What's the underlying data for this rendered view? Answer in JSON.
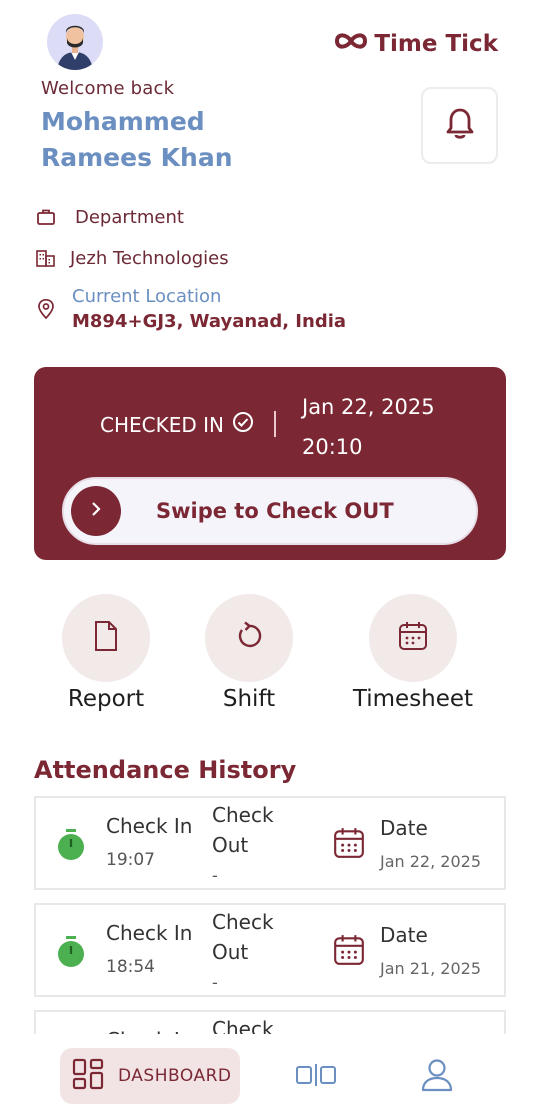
{
  "header": {
    "brand": "Time Tick",
    "welcome": "Welcome back",
    "user_name": "Mohammed Ramees Khan"
  },
  "info": {
    "department": "Department",
    "company": "Jezh Technologies",
    "location_label": "Current Location",
    "location_value": "M894+GJ3, Wayanad, India"
  },
  "check_card": {
    "status": "CHECKED IN",
    "date": "Jan 22, 2025",
    "time": "20:10",
    "swipe_label": "Swipe to Check OUT"
  },
  "actions": [
    {
      "label": "Report",
      "icon": "file-icon"
    },
    {
      "label": "Shift",
      "icon": "refresh-icon"
    },
    {
      "label": "Timesheet",
      "icon": "calendar-icon"
    }
  ],
  "history": {
    "title": "Attendance History",
    "checkin_label": "Check In",
    "checkout_label": "Check Out",
    "date_label": "Date",
    "records": [
      {
        "check_in": "19:07",
        "check_out": "-",
        "date": "Jan 22, 2025"
      },
      {
        "check_in": "18:54",
        "check_out": "-",
        "date": "Jan 21, 2025"
      },
      {
        "check_in": "",
        "check_out": "",
        "date": ""
      }
    ]
  },
  "nav": {
    "dashboard": "DASHBOARD"
  },
  "colors": {
    "primary": "#7b2834",
    "accent_blue": "#6a8fc0",
    "timer_green": "#4caf50"
  }
}
